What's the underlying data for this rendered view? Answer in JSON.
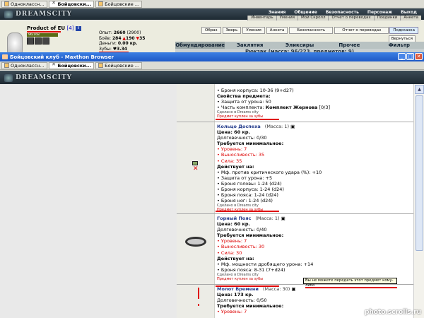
{
  "browser_tabs_top": [
    {
      "label": "Одноклассн...",
      "active": false
    },
    {
      "label": "Бойцовски...",
      "active": true
    },
    {
      "label": "Бойцовские ...",
      "active": false
    }
  ],
  "browser_tabs_bottom": [
    {
      "label": "Одноклассн...",
      "active": false
    },
    {
      "label": "Бойцовски...",
      "active": true
    },
    {
      "label": "Бойцовские ...",
      "active": false
    }
  ],
  "site": {
    "logo": "DREAMSCITY",
    "nav": [
      "Знания",
      "Общение",
      "Безопасность",
      "Персонаж",
      "Выход"
    ],
    "subnav": [
      "Инвентарь",
      "Умения",
      "Мой Скролл",
      "Отчет о переводах",
      "Поединки",
      "Анкета"
    ]
  },
  "hero": {
    "name": "Product of EU",
    "level": "[4]",
    "badge": "i",
    "hp": "96/168",
    "exp_label": "Опыт:",
    "exp_value": "2660",
    "exp_next": "(2900)",
    "battles_label": "Боёв:",
    "battles_value": "284",
    "wins": "190",
    "losses": "35",
    "money_label": "Деньги:",
    "money_value": "0.00 кр.",
    "teeth_label": "Зубы:",
    "teeth_value": "♥3.34",
    "buttons": [
      "Образ",
      "Зверь",
      "Умения",
      "Анкета"
    ],
    "security_button": "Безопасность",
    "transfers_button": "Отчет о переводах",
    "help": "Подсказка",
    "return": "Вернуться",
    "inventory_tabs": [
      "Обмундирование",
      "Заклятия",
      "Эликсиры",
      "Прочее",
      "Фильтр"
    ],
    "backpack": "Рюкзак (масса: 96/223, предметов: 9)"
  },
  "window": {
    "title": "Бойцовский клуб - Maxthon Browser"
  },
  "items": [
    {
      "title": "",
      "lines": [
        {
          "text": "• Броня корпуса: 10-36 (9+d27)"
        },
        {
          "text": "Свойства предмета:",
          "style": "bold"
        },
        {
          "text": "• Защита от урона: 50"
        },
        {
          "text": "• Часть комплекта: ",
          "bold_tail": "Комплект Жернова",
          "tail2": " [0/3]"
        }
      ],
      "made": "Сделано в Dreams city",
      "bought": "Предмет куплен за зубы"
    },
    {
      "title": "Кольцо Доспеха",
      "mass": "(Масса: 1)",
      "price": "Цена: 60 кр.",
      "durability": "Долговечность: 0/30",
      "req_title": "Требуется минимальное:",
      "req": [
        "• Уровень: 7",
        "• Выносливость: 35",
        "• Сила: 35"
      ],
      "acts_title": "Действует на:",
      "acts": [
        "• Мф. против критического удара (%): +10",
        "• Защита от урона: +5",
        "• Броня головы: 1-24 (d24)",
        "• Броня корпуса: 1-24 (d24)",
        "• Броня пояса: 1-24 (d24)",
        "• Броня ног: 1-24 (d24)"
      ],
      "made": "Сделано в Dreams city",
      "bought": "Предмет куплен за зубы"
    },
    {
      "title": "Горный Пояс",
      "mass": "(Масса: 1)",
      "price": "Цена: 60 кр.",
      "durability": "Долговечность: 0/40",
      "req_title": "Требуется минимальное:",
      "req": [
        "• Уровень: 7",
        "• Выносливость: 30",
        "• Сила: 30"
      ],
      "acts_title": "Действует на:",
      "acts": [
        "• Мф. мощности дробящего урона: +14",
        "• Броня пояса: 8-31 (7+d24)"
      ],
      "made": "Сделано в Dreams city",
      "bought": "Предмет куплен за зубы"
    },
    {
      "title": "Молот Времени",
      "mass": "(Масса: 30)",
      "price": "Цена: 173 кр.",
      "durability": "Долговечность: 0/50",
      "req_title": "Требуется минимальное:",
      "req": [
        "• Уровень: 7"
      ]
    }
  ],
  "tooltip": "Вы не можете передать этот предмет кому-либо",
  "watermark": "photo.scrolls.ru",
  "colors": {
    "accent_red": "#e00000",
    "title_blue": "#223a8a",
    "window_blue": "#2a6ad6"
  }
}
